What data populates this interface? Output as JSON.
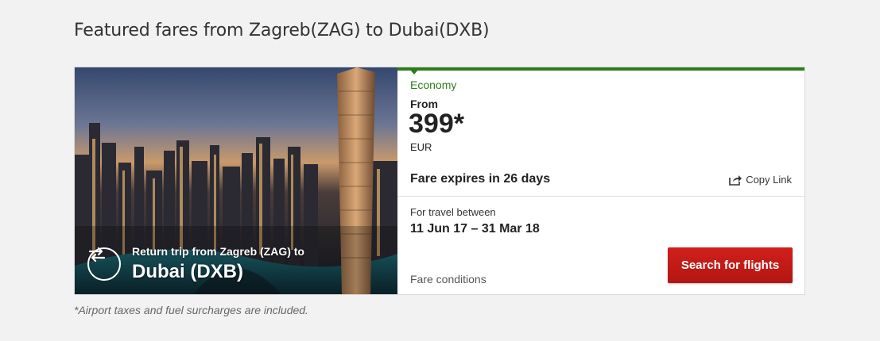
{
  "heading": "Featured fares from Zagreb(ZAG) to Dubai(DXB)",
  "card": {
    "trip_label": "Return trip from Zagreb (ZAG) to",
    "destination": "Dubai (DXB)",
    "cabin": "Economy",
    "from_label": "From",
    "price": "399*",
    "currency": "EUR",
    "expires": "Fare expires in 26 days",
    "copy_link": "Copy Link",
    "travel_label": "For travel between",
    "travel_dates": "11 Jun 17 – 31 Mar 18",
    "fare_conditions": "Fare conditions",
    "search_button": "Search for flights",
    "accent_color": "#2f7d1a",
    "button_color": "#c41b17",
    "icons": [
      "swap-arrows-icon",
      "share-icon"
    ]
  },
  "footnote": "*Airport taxes and fuel surcharges are included."
}
